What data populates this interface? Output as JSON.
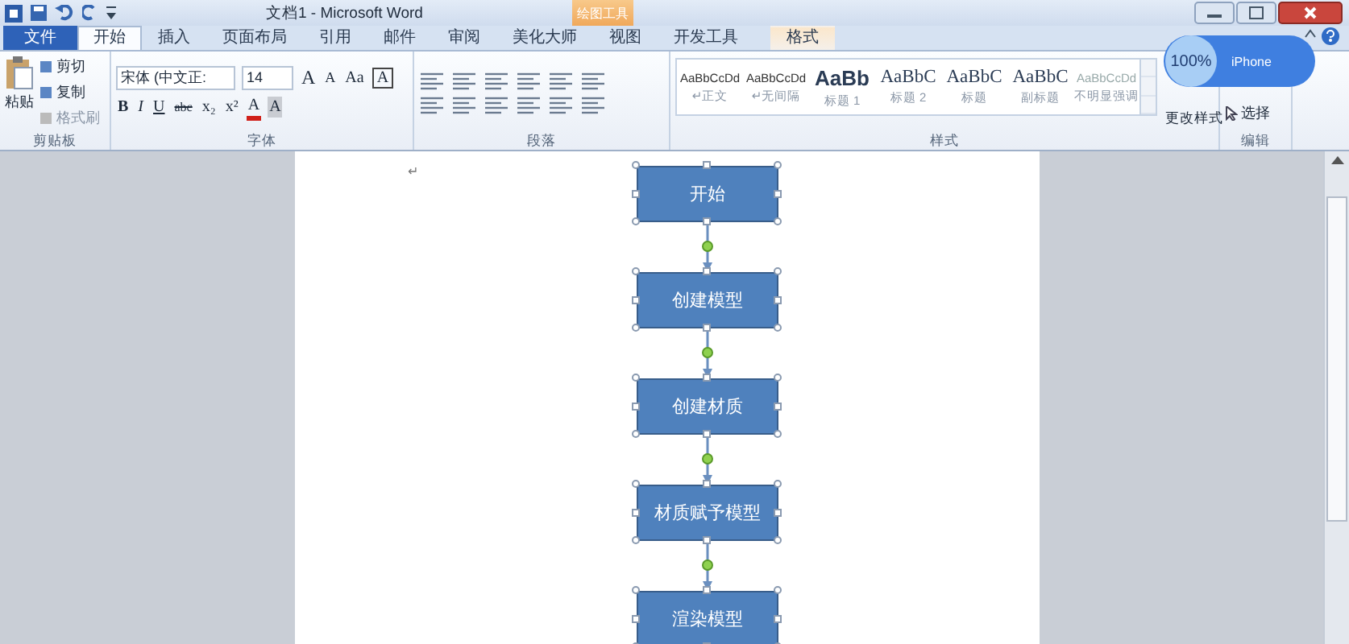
{
  "window": {
    "title": "文档1 - Microsoft Word",
    "context_tab_header": "绘图工具"
  },
  "tabs": [
    {
      "label": "文件",
      "kind": "file",
      "selected": false
    },
    {
      "label": "开始",
      "kind": "tab",
      "selected": true
    },
    {
      "label": "插入",
      "kind": "tab",
      "selected": false
    },
    {
      "label": "页面布局",
      "kind": "tab",
      "selected": false
    },
    {
      "label": "引用",
      "kind": "tab",
      "selected": false
    },
    {
      "label": "邮件",
      "kind": "tab",
      "selected": false
    },
    {
      "label": "审阅",
      "kind": "tab",
      "selected": false
    },
    {
      "label": "美化大师",
      "kind": "tab",
      "selected": false
    },
    {
      "label": "视图",
      "kind": "tab",
      "selected": false
    },
    {
      "label": "开发工具",
      "kind": "tab",
      "selected": false
    },
    {
      "label": "格式",
      "kind": "context",
      "selected": false
    }
  ],
  "clipboard": {
    "paste": "粘贴",
    "items": [
      "剪切",
      "复制",
      "格式刷"
    ],
    "label": "剪贴板"
  },
  "font": {
    "name": "宋体 (中文正:",
    "size": "14",
    "label": "字体",
    "top_buttons": [
      {
        "text": "A",
        "kind": "grow"
      },
      {
        "text": "A",
        "kind": "shrink"
      },
      {
        "text": "Aa",
        "kind": "plain"
      },
      {
        "text": "A",
        "kind": "boxed"
      }
    ],
    "bottom_buttons": [
      {
        "text": "B",
        "kind": "bold"
      },
      {
        "text": "I",
        "kind": "italic"
      },
      {
        "text": "U",
        "kind": "underline"
      },
      {
        "text": "abc",
        "kind": "strike"
      },
      {
        "text": "x₂",
        "kind": "plain"
      },
      {
        "text": "x²",
        "kind": "plain"
      },
      {
        "text": "A",
        "kind": "red"
      },
      {
        "text": "A",
        "kind": "shaded"
      }
    ]
  },
  "paragraph": {
    "label": "段落"
  },
  "styles": {
    "label": "样式",
    "items": [
      {
        "preview": "AaBbCcDd",
        "name": "↵正文",
        "kind": "small"
      },
      {
        "preview": "AaBbCcDd",
        "name": "↵无间隔",
        "kind": "small"
      },
      {
        "preview": "AaBb",
        "name": "标题 1",
        "kind": "heading1"
      },
      {
        "preview": "AaBbC",
        "name": "标题 2",
        "kind": "heading"
      },
      {
        "preview": "AaBbC",
        "name": "标题",
        "kind": "heading"
      },
      {
        "preview": "AaBbC",
        "name": "副标题",
        "kind": "heading"
      },
      {
        "preview": "AaBbCcDd",
        "name": "不明显强调",
        "kind": "subtle"
      }
    ],
    "change": "更改样式"
  },
  "editing": {
    "select": "选择",
    "label": "编辑"
  },
  "overlay": {
    "zoom": "100%",
    "device": "iPhone"
  },
  "document": {
    "paragraph_mark": "↵",
    "flowchart": [
      "开始",
      "创建模型",
      "创建材质",
      "材质赋予模型",
      "渲染模型"
    ]
  }
}
